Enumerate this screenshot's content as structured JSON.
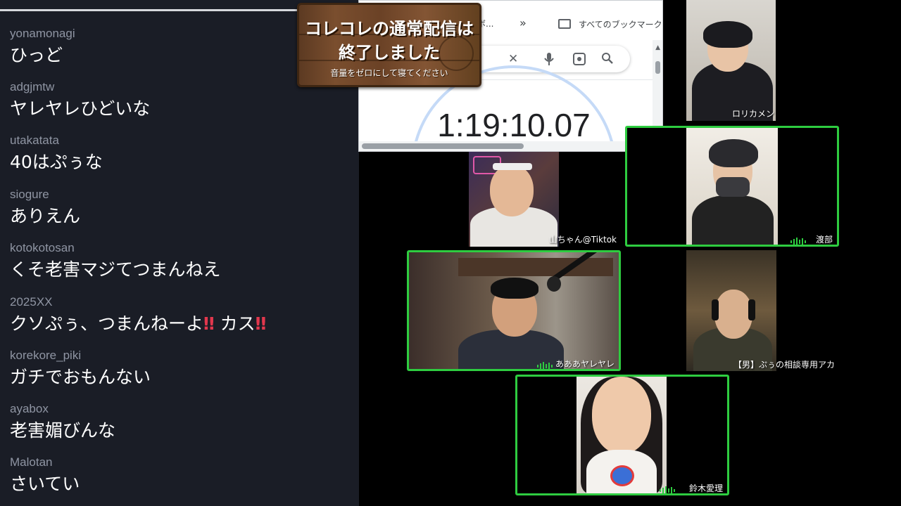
{
  "chat": {
    "messages": [
      {
        "user": "yonamonagi",
        "text": "ひっど"
      },
      {
        "user": "adgjmtw",
        "text": "ヤレヤレひどいな"
      },
      {
        "user": "utakatata",
        "text": "40はぷぅな"
      },
      {
        "user": "siogure",
        "text": "ありえん"
      },
      {
        "user": "kotokotosan",
        "text": "くそ老害マジてつまんねえ"
      },
      {
        "user": "2025XX",
        "text_before": "クソぷぅ、つまんねーよ",
        "bang1": "‼",
        "text_mid": "カス",
        "bang2": "‼"
      },
      {
        "user": "korekore_piki",
        "text": "ガチでおもんない"
      },
      {
        "user": "ayabox",
        "text": "老害媚びんな"
      },
      {
        "user": "Malotan",
        "text": "さいてい"
      }
    ]
  },
  "sign": {
    "line1": "コレコレの通常配信は",
    "line2": "終了しました",
    "subtitle": "音量をゼロにして寝てください"
  },
  "browser": {
    "bookmark_partial": "ボ...",
    "chevrons": "»",
    "all_bookmarks": "すべてのブックマーク",
    "clear_icon": "✕",
    "mic_icon": "🎤",
    "search_icon": "⌕",
    "timer": "1:19:10.07"
  },
  "participants": [
    {
      "name": "ロリカメン",
      "speaking": false
    },
    {
      "name": "渡部",
      "speaking": true
    },
    {
      "name": "山ちゃん@Tiktok",
      "speaking": false
    },
    {
      "name": "あああヤレヤレ",
      "speaking": true
    },
    {
      "name": "【男】ぷぅの相談専用アカ",
      "speaking": false
    },
    {
      "name": "鈴木愛理",
      "speaking": true
    }
  ],
  "colors": {
    "chat_bg": "#1a1d26",
    "username": "#8f95a3",
    "speaking_border": "#2ecc40",
    "emphasis_red": "#e2374d"
  }
}
